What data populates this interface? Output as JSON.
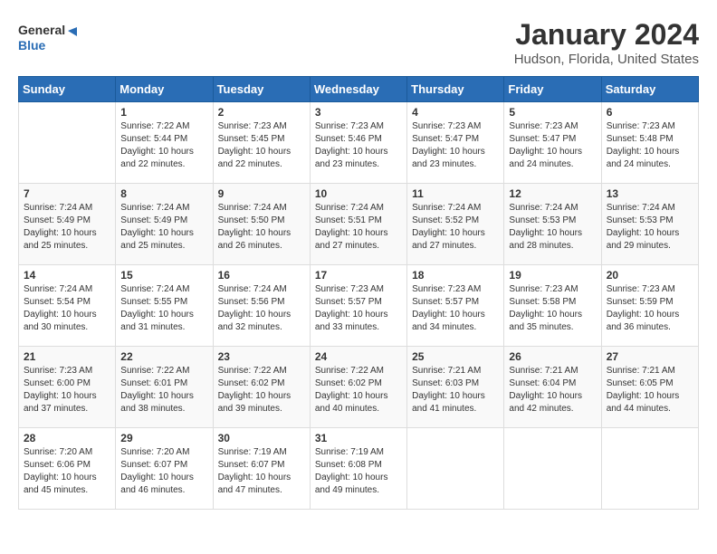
{
  "header": {
    "logo_general": "General",
    "logo_blue": "Blue",
    "month_title": "January 2024",
    "location": "Hudson, Florida, United States"
  },
  "days_of_week": [
    "Sunday",
    "Monday",
    "Tuesday",
    "Wednesday",
    "Thursday",
    "Friday",
    "Saturday"
  ],
  "weeks": [
    [
      {
        "day": "",
        "info": ""
      },
      {
        "day": "1",
        "info": "Sunrise: 7:22 AM\nSunset: 5:44 PM\nDaylight: 10 hours\nand 22 minutes."
      },
      {
        "day": "2",
        "info": "Sunrise: 7:23 AM\nSunset: 5:45 PM\nDaylight: 10 hours\nand 22 minutes."
      },
      {
        "day": "3",
        "info": "Sunrise: 7:23 AM\nSunset: 5:46 PM\nDaylight: 10 hours\nand 23 minutes."
      },
      {
        "day": "4",
        "info": "Sunrise: 7:23 AM\nSunset: 5:47 PM\nDaylight: 10 hours\nand 23 minutes."
      },
      {
        "day": "5",
        "info": "Sunrise: 7:23 AM\nSunset: 5:47 PM\nDaylight: 10 hours\nand 24 minutes."
      },
      {
        "day": "6",
        "info": "Sunrise: 7:23 AM\nSunset: 5:48 PM\nDaylight: 10 hours\nand 24 minutes."
      }
    ],
    [
      {
        "day": "7",
        "info": "Sunrise: 7:24 AM\nSunset: 5:49 PM\nDaylight: 10 hours\nand 25 minutes."
      },
      {
        "day": "8",
        "info": "Sunrise: 7:24 AM\nSunset: 5:49 PM\nDaylight: 10 hours\nand 25 minutes."
      },
      {
        "day": "9",
        "info": "Sunrise: 7:24 AM\nSunset: 5:50 PM\nDaylight: 10 hours\nand 26 minutes."
      },
      {
        "day": "10",
        "info": "Sunrise: 7:24 AM\nSunset: 5:51 PM\nDaylight: 10 hours\nand 27 minutes."
      },
      {
        "day": "11",
        "info": "Sunrise: 7:24 AM\nSunset: 5:52 PM\nDaylight: 10 hours\nand 27 minutes."
      },
      {
        "day": "12",
        "info": "Sunrise: 7:24 AM\nSunset: 5:53 PM\nDaylight: 10 hours\nand 28 minutes."
      },
      {
        "day": "13",
        "info": "Sunrise: 7:24 AM\nSunset: 5:53 PM\nDaylight: 10 hours\nand 29 minutes."
      }
    ],
    [
      {
        "day": "14",
        "info": "Sunrise: 7:24 AM\nSunset: 5:54 PM\nDaylight: 10 hours\nand 30 minutes."
      },
      {
        "day": "15",
        "info": "Sunrise: 7:24 AM\nSunset: 5:55 PM\nDaylight: 10 hours\nand 31 minutes."
      },
      {
        "day": "16",
        "info": "Sunrise: 7:24 AM\nSunset: 5:56 PM\nDaylight: 10 hours\nand 32 minutes."
      },
      {
        "day": "17",
        "info": "Sunrise: 7:23 AM\nSunset: 5:57 PM\nDaylight: 10 hours\nand 33 minutes."
      },
      {
        "day": "18",
        "info": "Sunrise: 7:23 AM\nSunset: 5:57 PM\nDaylight: 10 hours\nand 34 minutes."
      },
      {
        "day": "19",
        "info": "Sunrise: 7:23 AM\nSunset: 5:58 PM\nDaylight: 10 hours\nand 35 minutes."
      },
      {
        "day": "20",
        "info": "Sunrise: 7:23 AM\nSunset: 5:59 PM\nDaylight: 10 hours\nand 36 minutes."
      }
    ],
    [
      {
        "day": "21",
        "info": "Sunrise: 7:23 AM\nSunset: 6:00 PM\nDaylight: 10 hours\nand 37 minutes."
      },
      {
        "day": "22",
        "info": "Sunrise: 7:22 AM\nSunset: 6:01 PM\nDaylight: 10 hours\nand 38 minutes."
      },
      {
        "day": "23",
        "info": "Sunrise: 7:22 AM\nSunset: 6:02 PM\nDaylight: 10 hours\nand 39 minutes."
      },
      {
        "day": "24",
        "info": "Sunrise: 7:22 AM\nSunset: 6:02 PM\nDaylight: 10 hours\nand 40 minutes."
      },
      {
        "day": "25",
        "info": "Sunrise: 7:21 AM\nSunset: 6:03 PM\nDaylight: 10 hours\nand 41 minutes."
      },
      {
        "day": "26",
        "info": "Sunrise: 7:21 AM\nSunset: 6:04 PM\nDaylight: 10 hours\nand 42 minutes."
      },
      {
        "day": "27",
        "info": "Sunrise: 7:21 AM\nSunset: 6:05 PM\nDaylight: 10 hours\nand 44 minutes."
      }
    ],
    [
      {
        "day": "28",
        "info": "Sunrise: 7:20 AM\nSunset: 6:06 PM\nDaylight: 10 hours\nand 45 minutes."
      },
      {
        "day": "29",
        "info": "Sunrise: 7:20 AM\nSunset: 6:07 PM\nDaylight: 10 hours\nand 46 minutes."
      },
      {
        "day": "30",
        "info": "Sunrise: 7:19 AM\nSunset: 6:07 PM\nDaylight: 10 hours\nand 47 minutes."
      },
      {
        "day": "31",
        "info": "Sunrise: 7:19 AM\nSunset: 6:08 PM\nDaylight: 10 hours\nand 49 minutes."
      },
      {
        "day": "",
        "info": ""
      },
      {
        "day": "",
        "info": ""
      },
      {
        "day": "",
        "info": ""
      }
    ]
  ]
}
